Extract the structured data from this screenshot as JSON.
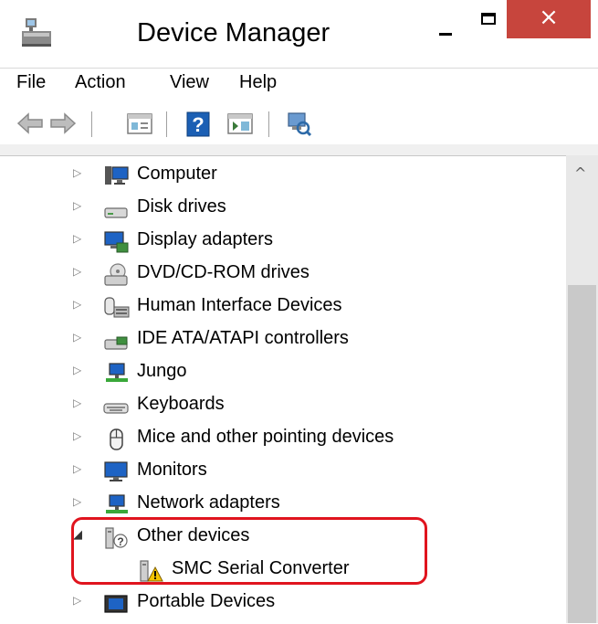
{
  "window": {
    "title": "Device Manager",
    "close_glyph": "×"
  },
  "menu": [
    "File",
    "Action",
    "View",
    "Help"
  ],
  "toolbar": {
    "icons": [
      "back-arrow-icon",
      "forward-arrow-icon",
      "properties-icon",
      "help-icon",
      "show-hide-pane-icon",
      "scan-hardware-icon"
    ],
    "help_glyph": "?"
  },
  "scrollbar": {
    "up_glyph": "^"
  },
  "tree": [
    {
      "label": "Computer",
      "icon": "computer-icon",
      "expanded": false
    },
    {
      "label": "Disk drives",
      "icon": "disk-drive-icon",
      "expanded": false
    },
    {
      "label": "Display adapters",
      "icon": "display-adapter-icon",
      "expanded": false
    },
    {
      "label": "DVD/CD-ROM drives",
      "icon": "dvd-drive-icon",
      "expanded": false
    },
    {
      "label": "Human Interface Devices",
      "icon": "hid-icon",
      "expanded": false
    },
    {
      "label": "IDE ATA/ATAPI controllers",
      "icon": "ide-controller-icon",
      "expanded": false
    },
    {
      "label": "Jungo",
      "icon": "jungo-icon",
      "expanded": false
    },
    {
      "label": "Keyboards",
      "icon": "keyboard-icon",
      "expanded": false
    },
    {
      "label": "Mice and other pointing devices",
      "icon": "mouse-icon",
      "expanded": false
    },
    {
      "label": "Monitors",
      "icon": "monitor-icon",
      "expanded": false
    },
    {
      "label": "Network adapters",
      "icon": "network-adapter-icon",
      "expanded": false
    },
    {
      "label": "Other devices",
      "icon": "unknown-device-icon",
      "expanded": true
    },
    {
      "label": "SMC Serial Converter",
      "icon": "warning-device-icon",
      "child": true
    },
    {
      "label": "Portable Devices",
      "icon": "portable-device-icon",
      "expanded": false
    }
  ],
  "colors": {
    "close_button": "#c7453d",
    "highlight_border": "#e0141e",
    "scrollbar_track": "#e8e8e8",
    "scrollbar_thumb": "#c9c9c9"
  }
}
